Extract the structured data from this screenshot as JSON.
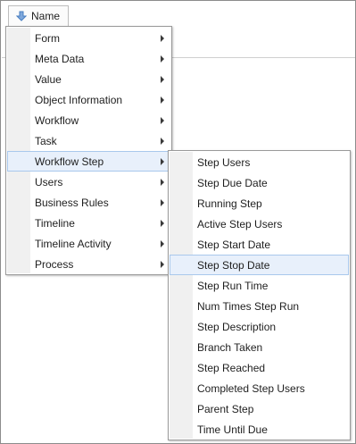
{
  "header": {
    "column_label": "Name",
    "sort_icon": "down-arrow-icon"
  },
  "menu": {
    "items": [
      {
        "label": "Form"
      },
      {
        "label": "Meta Data"
      },
      {
        "label": "Value"
      },
      {
        "label": "Object Information"
      },
      {
        "label": "Workflow"
      },
      {
        "label": "Task"
      },
      {
        "label": "Workflow Step"
      },
      {
        "label": "Users"
      },
      {
        "label": "Business Rules"
      },
      {
        "label": "Timeline"
      },
      {
        "label": "Timeline Activity"
      },
      {
        "label": "Process"
      }
    ],
    "highlighted_index": 6
  },
  "submenu": {
    "items": [
      {
        "label": "Step Users"
      },
      {
        "label": "Step Due Date"
      },
      {
        "label": "Running Step"
      },
      {
        "label": "Active Step Users"
      },
      {
        "label": "Step Start Date"
      },
      {
        "label": "Step Stop Date"
      },
      {
        "label": "Step Run Time"
      },
      {
        "label": "Num Times Step Run"
      },
      {
        "label": "Step Description"
      },
      {
        "label": "Branch Taken"
      },
      {
        "label": "Step Reached"
      },
      {
        "label": "Completed Step Users"
      },
      {
        "label": "Parent Step"
      },
      {
        "label": "Time Until Due"
      }
    ],
    "highlighted_index": 5
  },
  "colors": {
    "highlight_bg": "#e8f0fb",
    "highlight_border": "#a9c8ec",
    "icon_blue": "#4a7fc1"
  }
}
